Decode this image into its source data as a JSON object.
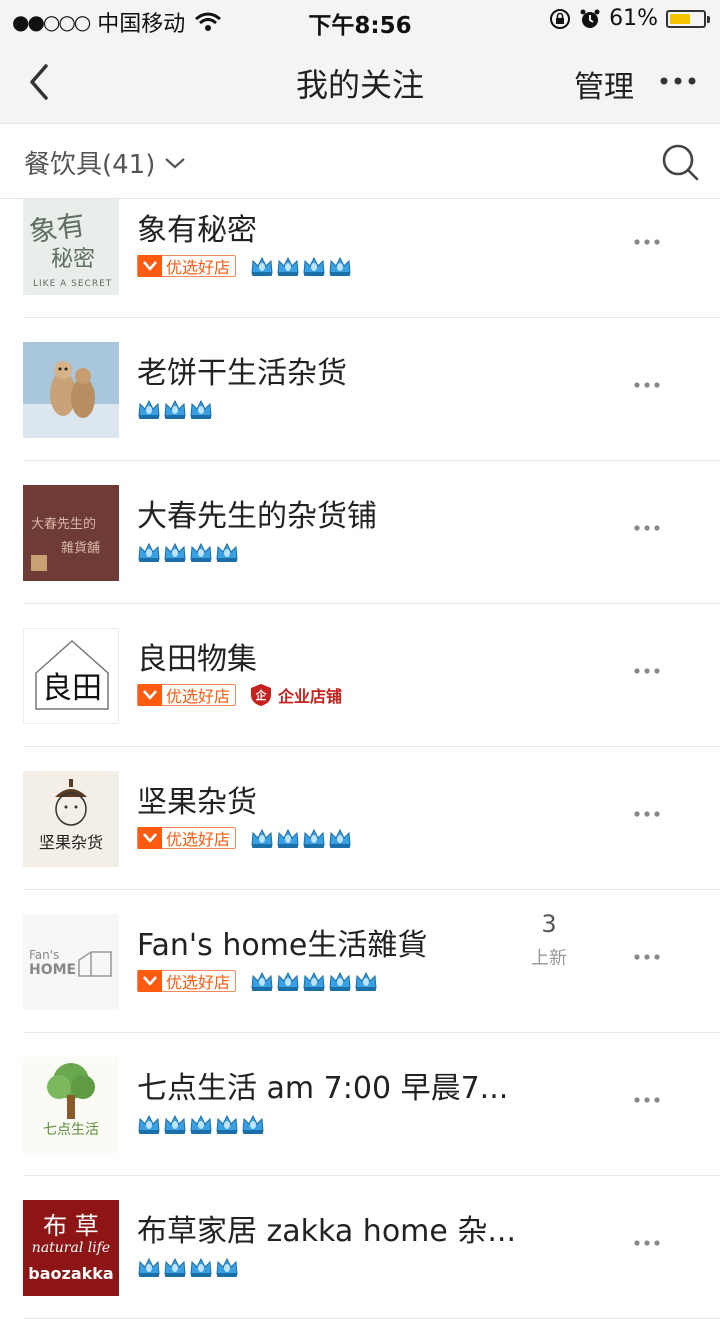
{
  "status": {
    "signal_dots": "●●○○○",
    "carrier": "中国移动",
    "time": "下午8:56",
    "battery": "61%",
    "battery_level": 0.61,
    "battery_color": "#f5c400"
  },
  "nav": {
    "title": "我的关注",
    "manage": "管理"
  },
  "filter": {
    "label": "餐饮具(41)"
  },
  "badges": {
    "pick_label": "优选好店",
    "enterprise_label": "企业店铺",
    "enterprise_icon_char": "企"
  },
  "colors": {
    "accent_orange": "#ff5b10",
    "crown_blue": "#3aa0e4",
    "enterprise_red": "#c8201c"
  },
  "shops": [
    {
      "name": "象有秘密",
      "pick": true,
      "enterprise": false,
      "crowns": 4,
      "logo_text": [
        "象有",
        "秘密"
      ],
      "logo_caption": "LIKE A SECRET",
      "logo_style": "secret"
    },
    {
      "name": "老饼干生活杂货",
      "pick": false,
      "enterprise": false,
      "crowns": 3,
      "logo_style": "bears"
    },
    {
      "name": "大春先生的杂货铺",
      "pick": false,
      "enterprise": false,
      "crowns": 4,
      "logo_text": [
        "大春先生的",
        "雜貨舖"
      ],
      "logo_style": "brown"
    },
    {
      "name": "良田物集",
      "pick": true,
      "enterprise": true,
      "crowns": 0,
      "logo_text": [
        "良田"
      ],
      "logo_style": "house"
    },
    {
      "name": "坚果杂货",
      "pick": true,
      "enterprise": false,
      "crowns": 4,
      "logo_text": [
        "坚果杂货"
      ],
      "logo_style": "acorn"
    },
    {
      "name": "Fan's home生活雜貨",
      "pick": true,
      "enterprise": false,
      "crowns": 5,
      "new_count": "3",
      "new_label": "上新",
      "logo_text": [
        "Fan's",
        "HOME"
      ],
      "logo_style": "fanshome"
    },
    {
      "name": "七点生活 am 7:00  早晨7...",
      "pick": false,
      "enterprise": false,
      "crowns": 5,
      "logo_text": [
        "七点生活"
      ],
      "logo_style": "tree"
    },
    {
      "name": "布草家居 zakka home 杂...",
      "pick": false,
      "enterprise": false,
      "crowns": 4,
      "logo_text": [
        "布 草",
        "natural life",
        "baozakka"
      ],
      "logo_style": "red"
    }
  ]
}
